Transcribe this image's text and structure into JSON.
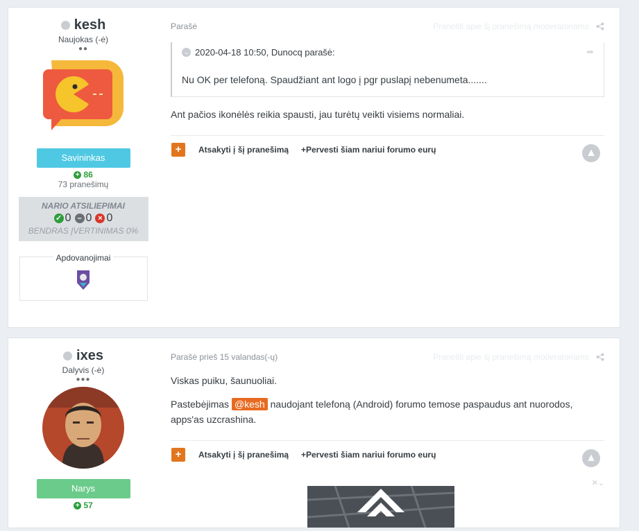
{
  "posts": [
    {
      "author": {
        "name": "kesh",
        "rank": "Naujokas (-ė)",
        "pips": "●●",
        "group": "Savininkas",
        "reputation": "86",
        "post_count": "73 pranešimų",
        "feedback": {
          "title": "NARIO ATSILIEPIMAI",
          "positive": "0",
          "neutral": "0",
          "negative": "0",
          "overall": "BENDRAS ĮVERTINIMAS 0%"
        },
        "awards_title": "Apdovanojimai"
      },
      "meta": "Parašė",
      "report": "Pranešti apie šį pranešimą moderatoriams",
      "quote": {
        "header": "2020-04-18 10:50, Dunocq parašė:",
        "body": "Nu OK per telefoną.  Spaudžiant ant logo į pgr puslapį nebenumeta......."
      },
      "text": "Ant pačios ikonėlės reikia spausti, jau turėtų veikti visiems normaliai.",
      "reply_label": "Atsakyti į šį pranešimą",
      "transfer_label": "+Pervesti šiam nariui forumo eurų"
    },
    {
      "author": {
        "name": "ixes",
        "rank": "Dalyvis (-ė)",
        "pips": "●●●",
        "group": "Narys",
        "reputation": "57"
      },
      "meta": "Parašė prieš 15 valandas(-ų)",
      "report": "Pranešti apie šį pranešimą moderatoriams",
      "text1": "Viskas puiku, šaunuoliai.",
      "text2_pre": "Pastebėjimas",
      "mention": "@kesh",
      "text2_post": "naudojant telefoną (Android) forumo temose paspaudus ant nuorodos, apps'as uzcrashina.",
      "reply_label": "Atsakyti į šį pranešimą",
      "transfer_label": "+Pervesti šiam nariui forumo eurų"
    }
  ],
  "colors": {
    "owner_badge": "#4fc9e3",
    "member_badge": "#6acb8a",
    "accent": "#e2761e",
    "positive": "#2e9e3b",
    "negative": "#d9362b",
    "neutral": "#6b7075"
  },
  "icons": [
    "share-icon",
    "reply-arrow-icon",
    "plus-icon",
    "arrow-up-icon",
    "chevron-down-icon"
  ]
}
